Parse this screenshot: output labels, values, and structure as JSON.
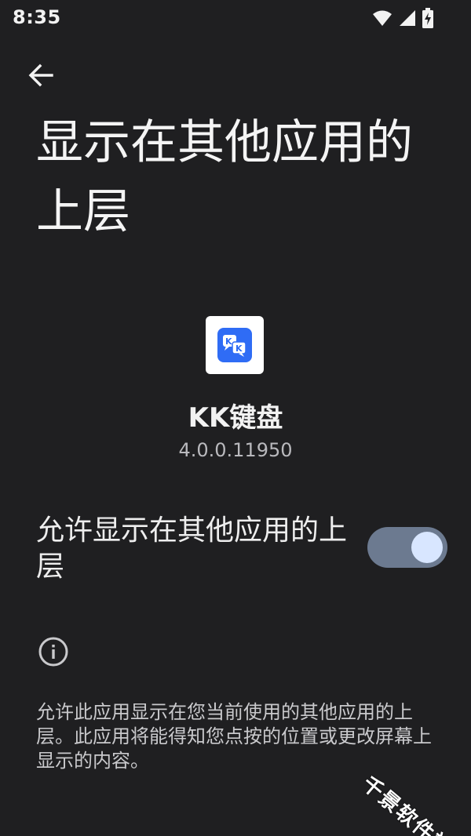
{
  "status_bar": {
    "time": "8:35",
    "icons": [
      "wifi-icon",
      "signal-icon",
      "battery-charging-icon"
    ]
  },
  "header": {
    "back_icon": "arrow-left-icon",
    "title": "显示在其他应用的上层"
  },
  "app": {
    "icon": "kk-keyboard-app-icon",
    "icon_color": "#2f6cf5",
    "name": "KK键盘",
    "version": "4.0.0.11950"
  },
  "permission": {
    "label": "允许显示在其他应用的上层",
    "enabled": true,
    "track_color": "#6c7a90",
    "thumb_color": "#d8e6ff"
  },
  "info": {
    "icon": "info-icon",
    "description": "允许此应用显示在您当前使用的其他应用的上层。此应用将能得知您点按的位置或更改屏幕上显示的内容。"
  },
  "watermark": {
    "text": "千景软件站"
  }
}
